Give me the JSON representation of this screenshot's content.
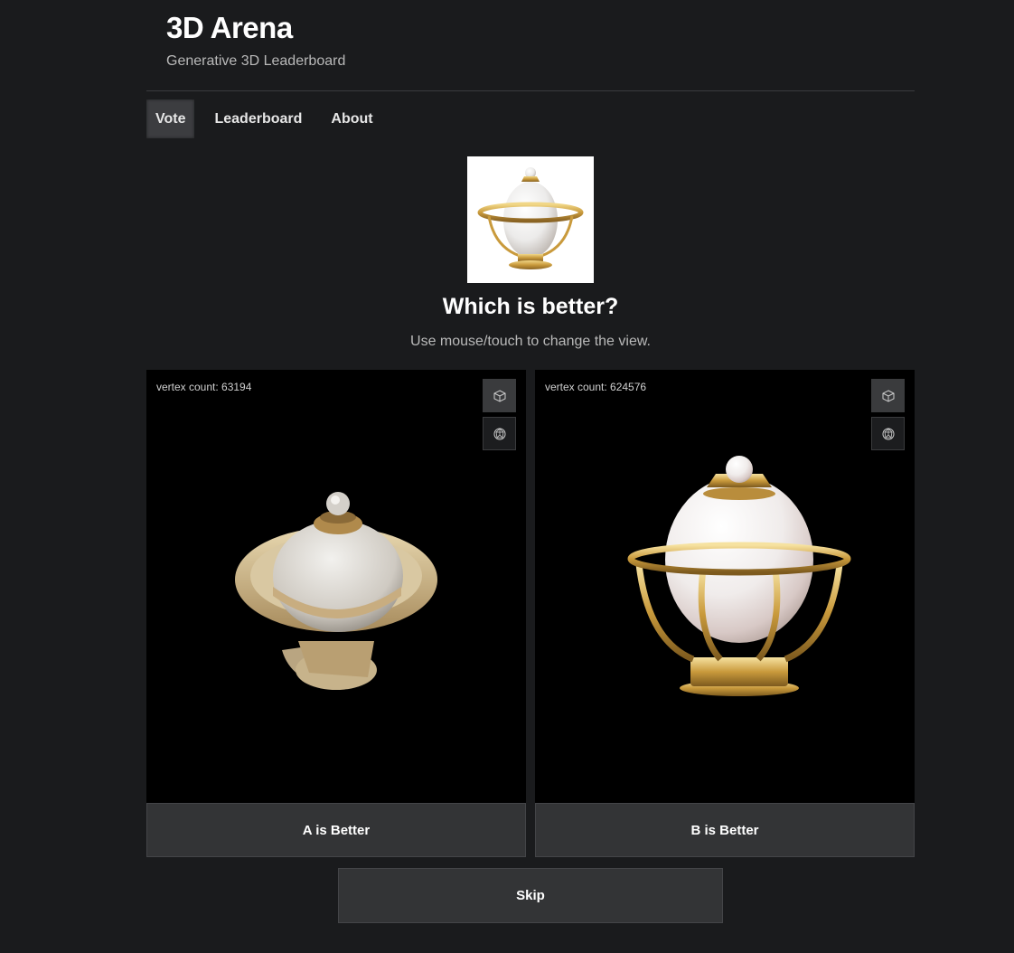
{
  "header": {
    "title": "3D Arena",
    "subtitle": "Generative 3D Leaderboard"
  },
  "tabs": [
    {
      "label": "Vote",
      "active": true
    },
    {
      "label": "Leaderboard",
      "active": false
    },
    {
      "label": "About",
      "active": false
    }
  ],
  "vote": {
    "question": "Which is better?",
    "hint": "Use mouse/touch to change the view.",
    "prompt_image": "pearl-bowl-prompt",
    "model_a": {
      "vertex_label": "vertex count: 63194",
      "button_label": "A is Better"
    },
    "model_b": {
      "vertex_label": "vertex count: 624576",
      "button_label": "B is Better"
    },
    "skip_label": "Skip"
  },
  "icons": {
    "mesh_view": "cube-icon",
    "wireframe_view": "wireframe-sphere-icon"
  },
  "colors": {
    "background": "#1a1b1d",
    "viewer_background": "#000000",
    "button_background": "#333436",
    "gold": "#c9a24a",
    "pearl": "#efeeee"
  }
}
